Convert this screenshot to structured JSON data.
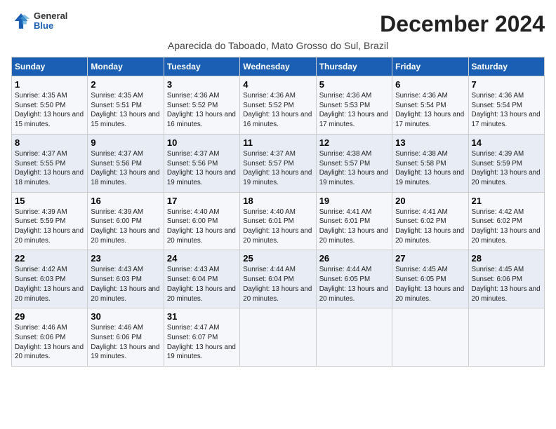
{
  "header": {
    "logo_general": "General",
    "logo_blue": "Blue",
    "month_title": "December 2024",
    "location": "Aparecida do Taboado, Mato Grosso do Sul, Brazil"
  },
  "days_of_week": [
    "Sunday",
    "Monday",
    "Tuesday",
    "Wednesday",
    "Thursday",
    "Friday",
    "Saturday"
  ],
  "weeks": [
    [
      {
        "day": "1",
        "info": "Sunrise: 4:35 AM\nSunset: 5:50 PM\nDaylight: 13 hours and 15 minutes."
      },
      {
        "day": "2",
        "info": "Sunrise: 4:35 AM\nSunset: 5:51 PM\nDaylight: 13 hours and 15 minutes."
      },
      {
        "day": "3",
        "info": "Sunrise: 4:36 AM\nSunset: 5:52 PM\nDaylight: 13 hours and 16 minutes."
      },
      {
        "day": "4",
        "info": "Sunrise: 4:36 AM\nSunset: 5:52 PM\nDaylight: 13 hours and 16 minutes."
      },
      {
        "day": "5",
        "info": "Sunrise: 4:36 AM\nSunset: 5:53 PM\nDaylight: 13 hours and 17 minutes."
      },
      {
        "day": "6",
        "info": "Sunrise: 4:36 AM\nSunset: 5:54 PM\nDaylight: 13 hours and 17 minutes."
      },
      {
        "day": "7",
        "info": "Sunrise: 4:36 AM\nSunset: 5:54 PM\nDaylight: 13 hours and 17 minutes."
      }
    ],
    [
      {
        "day": "8",
        "info": "Sunrise: 4:37 AM\nSunset: 5:55 PM\nDaylight: 13 hours and 18 minutes."
      },
      {
        "day": "9",
        "info": "Sunrise: 4:37 AM\nSunset: 5:56 PM\nDaylight: 13 hours and 18 minutes."
      },
      {
        "day": "10",
        "info": "Sunrise: 4:37 AM\nSunset: 5:56 PM\nDaylight: 13 hours and 19 minutes."
      },
      {
        "day": "11",
        "info": "Sunrise: 4:37 AM\nSunset: 5:57 PM\nDaylight: 13 hours and 19 minutes."
      },
      {
        "day": "12",
        "info": "Sunrise: 4:38 AM\nSunset: 5:57 PM\nDaylight: 13 hours and 19 minutes."
      },
      {
        "day": "13",
        "info": "Sunrise: 4:38 AM\nSunset: 5:58 PM\nDaylight: 13 hours and 19 minutes."
      },
      {
        "day": "14",
        "info": "Sunrise: 4:39 AM\nSunset: 5:59 PM\nDaylight: 13 hours and 20 minutes."
      }
    ],
    [
      {
        "day": "15",
        "info": "Sunrise: 4:39 AM\nSunset: 5:59 PM\nDaylight: 13 hours and 20 minutes."
      },
      {
        "day": "16",
        "info": "Sunrise: 4:39 AM\nSunset: 6:00 PM\nDaylight: 13 hours and 20 minutes."
      },
      {
        "day": "17",
        "info": "Sunrise: 4:40 AM\nSunset: 6:00 PM\nDaylight: 13 hours and 20 minutes."
      },
      {
        "day": "18",
        "info": "Sunrise: 4:40 AM\nSunset: 6:01 PM\nDaylight: 13 hours and 20 minutes."
      },
      {
        "day": "19",
        "info": "Sunrise: 4:41 AM\nSunset: 6:01 PM\nDaylight: 13 hours and 20 minutes."
      },
      {
        "day": "20",
        "info": "Sunrise: 4:41 AM\nSunset: 6:02 PM\nDaylight: 13 hours and 20 minutes."
      },
      {
        "day": "21",
        "info": "Sunrise: 4:42 AM\nSunset: 6:02 PM\nDaylight: 13 hours and 20 minutes."
      }
    ],
    [
      {
        "day": "22",
        "info": "Sunrise: 4:42 AM\nSunset: 6:03 PM\nDaylight: 13 hours and 20 minutes."
      },
      {
        "day": "23",
        "info": "Sunrise: 4:43 AM\nSunset: 6:03 PM\nDaylight: 13 hours and 20 minutes."
      },
      {
        "day": "24",
        "info": "Sunrise: 4:43 AM\nSunset: 6:04 PM\nDaylight: 13 hours and 20 minutes."
      },
      {
        "day": "25",
        "info": "Sunrise: 4:44 AM\nSunset: 6:04 PM\nDaylight: 13 hours and 20 minutes."
      },
      {
        "day": "26",
        "info": "Sunrise: 4:44 AM\nSunset: 6:05 PM\nDaylight: 13 hours and 20 minutes."
      },
      {
        "day": "27",
        "info": "Sunrise: 4:45 AM\nSunset: 6:05 PM\nDaylight: 13 hours and 20 minutes."
      },
      {
        "day": "28",
        "info": "Sunrise: 4:45 AM\nSunset: 6:06 PM\nDaylight: 13 hours and 20 minutes."
      }
    ],
    [
      {
        "day": "29",
        "info": "Sunrise: 4:46 AM\nSunset: 6:06 PM\nDaylight: 13 hours and 20 minutes."
      },
      {
        "day": "30",
        "info": "Sunrise: 4:46 AM\nSunset: 6:06 PM\nDaylight: 13 hours and 19 minutes."
      },
      {
        "day": "31",
        "info": "Sunrise: 4:47 AM\nSunset: 6:07 PM\nDaylight: 13 hours and 19 minutes."
      },
      null,
      null,
      null,
      null
    ]
  ]
}
